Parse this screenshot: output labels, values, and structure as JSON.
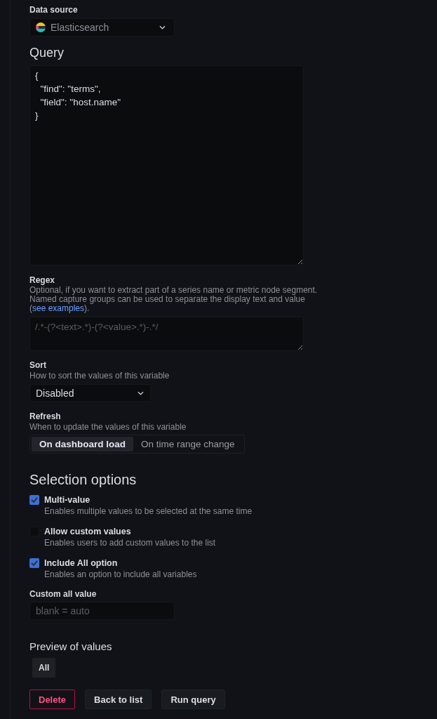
{
  "data_source": {
    "label": "Data source",
    "value": "Elasticsearch"
  },
  "query": {
    "heading": "Query",
    "value": "{\n  \"find\": \"terms\",\n  \"field\": \"host.name\"\n}"
  },
  "regex": {
    "label": "Regex",
    "description": "Optional, if you want to extract part of a series name or metric node segment. Named capture groups can be used to separate the display text and value (",
    "link": "see examples",
    "description_after": ").",
    "placeholder": "/.*-(?<text>.*)-(?<value>.*)-.*/"
  },
  "sort": {
    "label": "Sort",
    "description": "How to sort the values of this variable",
    "value": "Disabled"
  },
  "refresh": {
    "label": "Refresh",
    "description": "When to update the values of this variable",
    "options": [
      {
        "label": "On dashboard load",
        "selected": true
      },
      {
        "label": "On time range change",
        "selected": false
      }
    ]
  },
  "selection_options": {
    "heading": "Selection options",
    "options": [
      {
        "label": "Multi-value",
        "description": "Enables multiple values to be selected at the same time",
        "checked": true
      },
      {
        "label": "Allow custom values",
        "description": "Enables users to add custom values to the list",
        "checked": false
      },
      {
        "label": "Include All option",
        "description": "Enables an option to include all variables",
        "checked": true
      }
    ],
    "custom_all_value": {
      "label": "Custom all value",
      "placeholder": "blank = auto"
    }
  },
  "preview": {
    "heading": "Preview of values",
    "values": [
      "All"
    ]
  },
  "buttons": [
    {
      "label": "Delete",
      "kind": "destructive"
    },
    {
      "label": "Back to list",
      "kind": "secondary"
    },
    {
      "label": "Run query",
      "kind": "secondary"
    }
  ]
}
